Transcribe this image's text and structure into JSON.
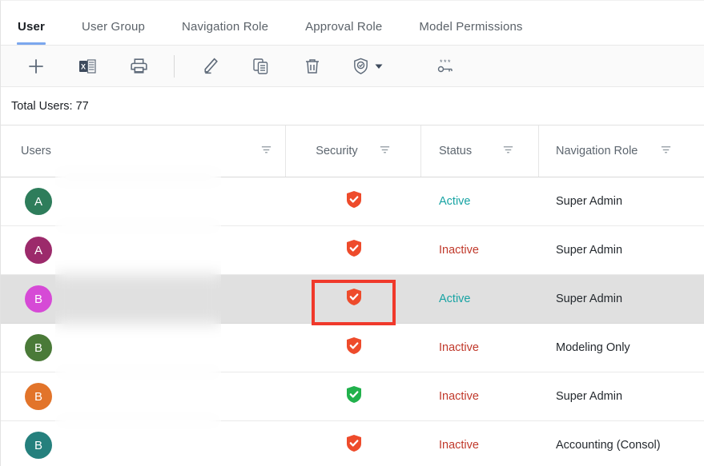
{
  "theme": {
    "accent": "#7ba7ee",
    "active_status_color": "#17a3a3",
    "inactive_status_color": "#c0392b",
    "shield_red": "#ee4b2b",
    "shield_green": "#21b14c",
    "annotation_box_color": "#f0392b",
    "selected_row_bg": "#e0e0e0"
  },
  "tabs": [
    {
      "label": "User",
      "active": true
    },
    {
      "label": "User Group",
      "active": false
    },
    {
      "label": "Navigation Role",
      "active": false
    },
    {
      "label": "Approval Role",
      "active": false
    },
    {
      "label": "Model Permissions",
      "active": false
    }
  ],
  "toolbar": {
    "add_label": "Add",
    "export_excel_label": "Export to Excel",
    "print_label": "Print",
    "edit_label": "Edit",
    "copy_label": "Copy",
    "delete_label": "Delete",
    "security_label": "Security",
    "password_label": "Reset Password"
  },
  "summary": {
    "total_users": "Total Users: 77"
  },
  "table": {
    "columns": [
      {
        "label": "Users",
        "filter_icon": "filter-icon"
      },
      {
        "label": "Security",
        "filter_icon": "filter-icon"
      },
      {
        "label": "Status",
        "filter_icon": "filter-icon"
      },
      {
        "label": "Navigation Role",
        "filter_icon": "filter-icon"
      }
    ],
    "rows": [
      {
        "initial": "A",
        "avatar_color": "#2e7d5b",
        "name": "",
        "security": "shield-check-red",
        "status": "Active",
        "status_type": "active",
        "nav_role": "Super Admin",
        "selected": false
      },
      {
        "initial": "A",
        "avatar_color": "#9c2a6b",
        "name": "",
        "security": "shield-check-red",
        "status": "Inactive",
        "status_type": "inactive",
        "nav_role": "Super Admin",
        "selected": false
      },
      {
        "initial": "B",
        "avatar_color": "#d64ad6",
        "name": "",
        "security": "shield-check-red",
        "status": "Active",
        "status_type": "active",
        "nav_role": "Super Admin",
        "selected": true
      },
      {
        "initial": "B",
        "avatar_color": "#4a7a38",
        "name": "",
        "security": "shield-check-red",
        "status": "Inactive",
        "status_type": "inactive",
        "nav_role": "Modeling Only",
        "selected": false
      },
      {
        "initial": "B",
        "avatar_color": "#e2742a",
        "name": "",
        "security": "shield-check-green",
        "status": "Inactive",
        "status_type": "inactive",
        "nav_role": "Super Admin",
        "selected": false
      },
      {
        "initial": "B",
        "avatar_color": "#25807d",
        "name": "",
        "security": "shield-check-red",
        "status": "Inactive",
        "status_type": "inactive",
        "nav_role": "Accounting (Consol)",
        "selected": false
      }
    ]
  },
  "annotation": {
    "target": "security-cell-row-3",
    "description": "red highlight box around security shield icon"
  }
}
